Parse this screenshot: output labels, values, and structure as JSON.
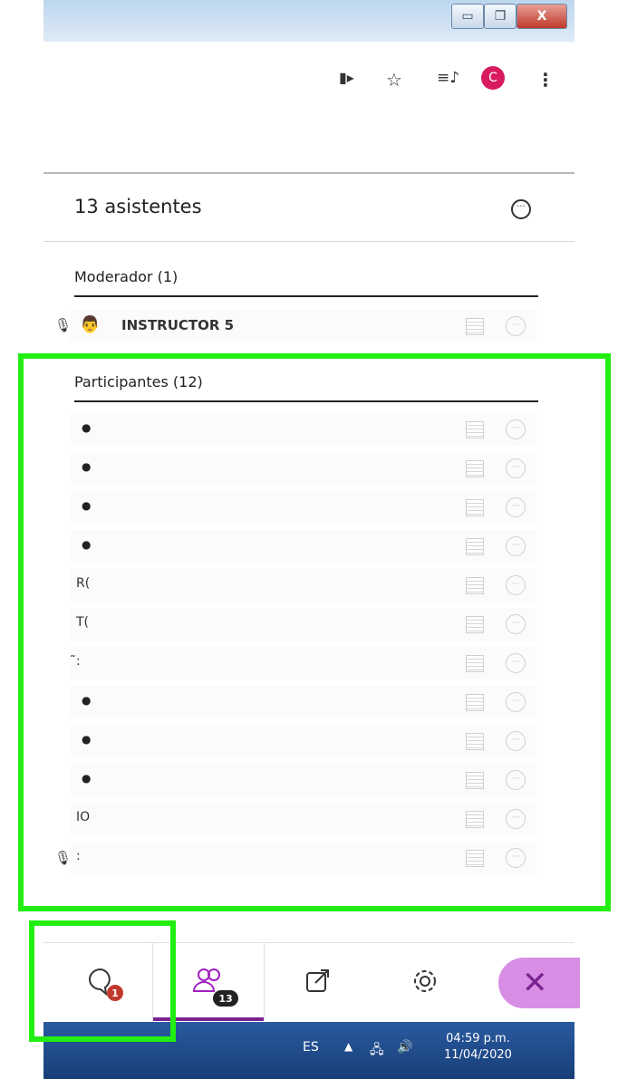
{
  "window": {
    "minimize": "▭",
    "maximize": "❐",
    "close": "X"
  },
  "toolbar": {
    "camera_icon": "▮▸",
    "star_icon": "☆",
    "playlist_icon": "≡♪",
    "profile_letter": "C",
    "menu_icon": "⋮"
  },
  "panel": {
    "title": "13 asistentes",
    "more_icon": "···",
    "moderator_header": "Moderador (1)",
    "moderator": {
      "name": "INSTRUCTOR 5"
    },
    "participants_header": "Participantes (12)",
    "participants": [
      {
        "label": ""
      },
      {
        "label": ""
      },
      {
        "label": ""
      },
      {
        "label": ""
      },
      {
        "label": "R("
      },
      {
        "label": "T("
      },
      {
        "label": "̃:"
      },
      {
        "label": ""
      },
      {
        "label": ""
      },
      {
        "label": ""
      },
      {
        "label": "IO"
      },
      {
        "label": ":"
      }
    ]
  },
  "bottom_bar": {
    "chat_badge": "1",
    "attendees_badge": "13",
    "leave_icon": "✕"
  },
  "taskbar": {
    "language": "ES",
    "time": "04:59 p.m.",
    "date": "11/04/2020"
  },
  "colors": {
    "highlight": "#22ee11",
    "accent": "#7a2290"
  }
}
